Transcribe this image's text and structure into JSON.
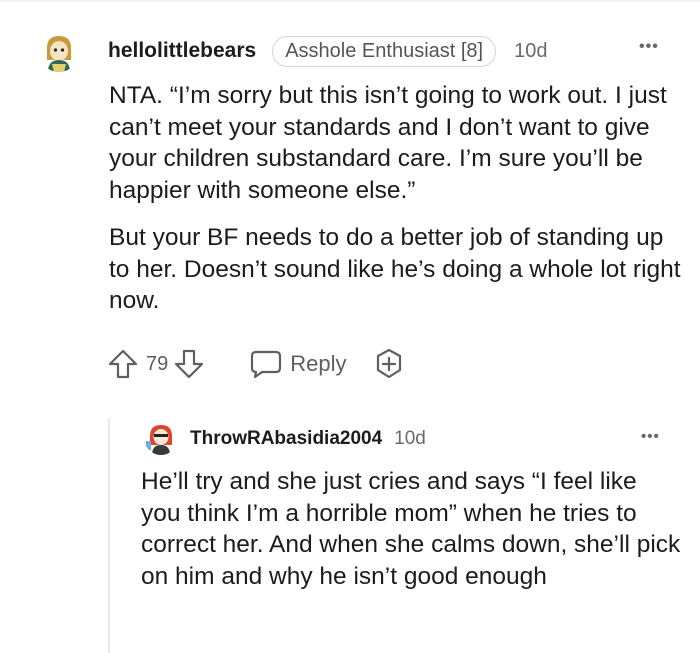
{
  "comment": {
    "username": "hellolittlebears",
    "flair": "Asshole Enthusiast [8]",
    "time": "10d",
    "more": "•••",
    "paragraph1": "NTA. “I’m sorry but this isn’t going to work out. I just can’t meet your standards and I don’t want to give your children substandard care. I’m sure you’ll be happier with someone else.”",
    "paragraph2": "But your BF needs to do a better job of standing up to her. Doesn’t sound like he’s doing a whole lot right now.",
    "votes": "79",
    "reply_label": "Reply"
  },
  "reply": {
    "username": "ThrowRAbasidia2004",
    "time": "10d",
    "more": "•••",
    "text": "He’ll try and she just cries and says “I feel like you think I’m a horrible mom” when he tries to correct her. And when she calms down, she’ll pick on him and why he isn’t good enough"
  },
  "icons": {
    "upvote": "arrow-up-icon",
    "downvote": "arrow-down-icon",
    "reply": "speech-bubble-icon",
    "award": "plus-badge-icon",
    "more": "ellipsis-icon"
  },
  "colors": {
    "text": "#1c1c1c",
    "meta": "#6a6a6a",
    "flair_border": "#d4d4d4",
    "thread_line": "#e8e8e8"
  }
}
